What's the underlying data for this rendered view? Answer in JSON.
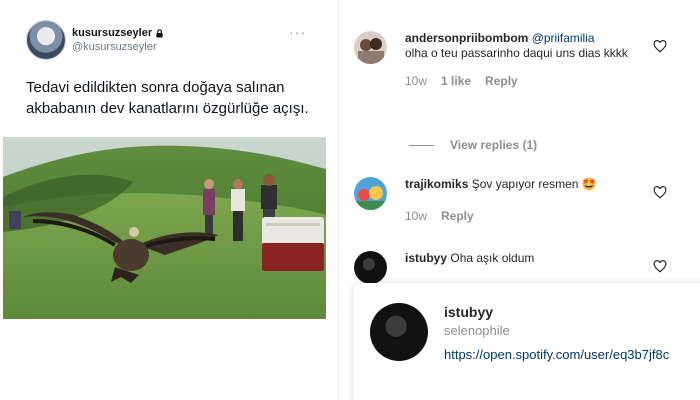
{
  "tweet": {
    "display_name": "kusursuzseyler",
    "handle": "@kusursuzseyler",
    "more": "···",
    "text": "Tedavi edildikten sonra doğaya salınan akbabanın dev kanatlarını özgürlüğe açışı."
  },
  "comments": [
    {
      "username": "andersonpriibombom",
      "mention": "@priifamilia",
      "text": "olha o teu passarinho daqui uns dias kkkk",
      "time": "10w",
      "likes": "1 like",
      "reply": "Reply"
    },
    {
      "username": "trajikomiks",
      "text": "Şov yapıyor resmen 🤩",
      "time": "10w",
      "reply": "Reply"
    },
    {
      "username": "istubyy",
      "text": "Oha aşık oldum"
    }
  ],
  "view_replies": "View replies (1)",
  "hover_card": {
    "username": "istubyy",
    "full_name": "selenophile",
    "link": "https://open.spotify.com/user/eq3b7jf8c"
  }
}
